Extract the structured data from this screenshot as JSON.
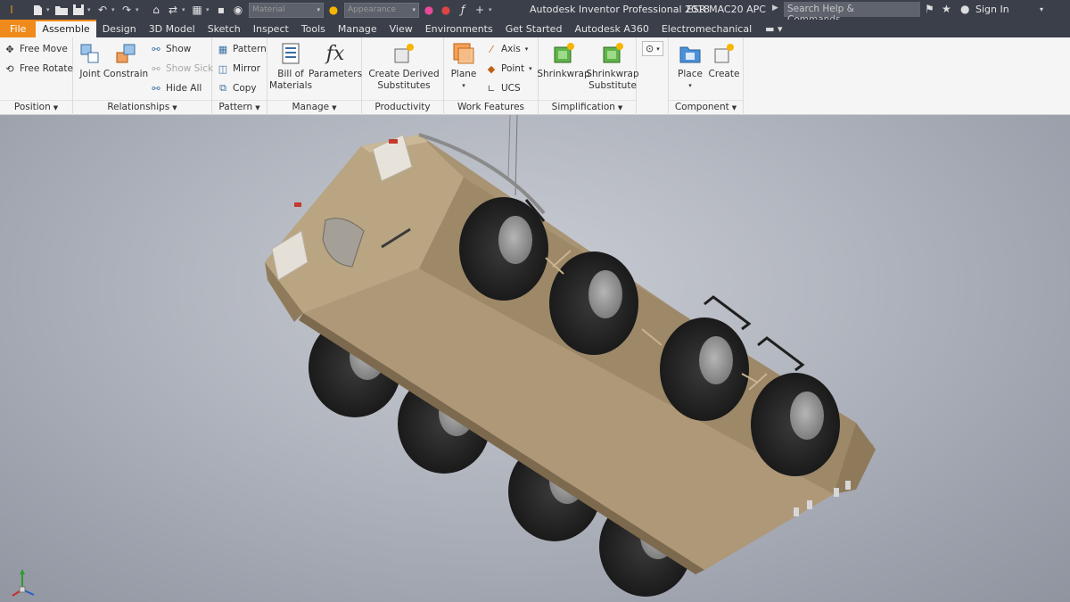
{
  "titlebar": {
    "app_title": "Autodesk Inventor Professional 2018",
    "file_name": "ESR MAC20 APC",
    "search_placeholder": "Search Help & Commands...",
    "sign_in": "Sign In",
    "material_combo": "Material",
    "appearance_combo": "Appearance"
  },
  "tabs": [
    "File",
    "Assemble",
    "Design",
    "3D Model",
    "Sketch",
    "Inspect",
    "Tools",
    "Manage",
    "View",
    "Environments",
    "Get Started",
    "Autodesk A360",
    "Electromechanical"
  ],
  "active_tab": "Assemble",
  "ribbon": {
    "position": {
      "label": "Position",
      "free_move": "Free Move",
      "free_rotate": "Free Rotate"
    },
    "relationships": {
      "label": "Relationships",
      "joint": "Joint",
      "constrain": "Constrain",
      "show": "Show",
      "show_sick": "Show Sick",
      "hide_all": "Hide All"
    },
    "pattern": {
      "label": "Pattern",
      "pattern": "Pattern",
      "mirror": "Mirror",
      "copy": "Copy"
    },
    "manage": {
      "label": "Manage",
      "bom_line1": "Bill of",
      "bom_line2": "Materials",
      "parameters": "Parameters"
    },
    "productivity": {
      "label": "Productivity",
      "cds_line1": "Create Derived",
      "cds_line2": "Substitutes"
    },
    "work_features": {
      "label": "Work Features",
      "plane": "Plane",
      "axis": "Axis",
      "point": "Point",
      "ucs": "UCS"
    },
    "simplification": {
      "label": "Simplification",
      "shrinkwrap": "Shrinkwrap",
      "sws_line1": "Shrinkwrap",
      "sws_line2": "Substitute"
    },
    "component": {
      "label": "Component",
      "place": "Place",
      "create": "Create"
    }
  },
  "colors": {
    "titlebar_bg": "#3a3f4a",
    "file_tab": "#f08a1c",
    "hull": "#b39d78",
    "tire": "#2b2b2b",
    "rim": "#9a9a9a"
  }
}
